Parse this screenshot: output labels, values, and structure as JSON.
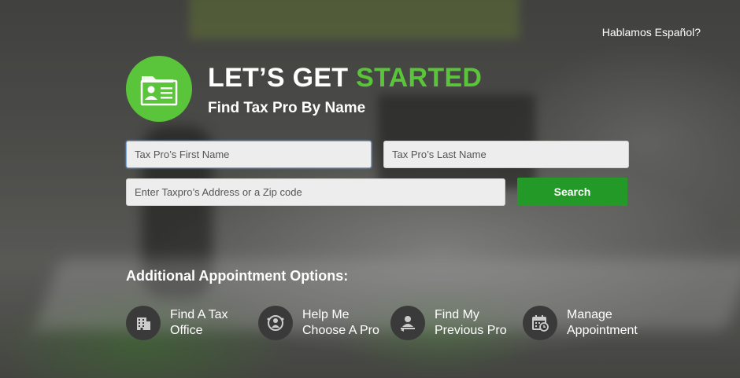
{
  "header": {
    "language_link": "Hablamos Español?"
  },
  "hero": {
    "title_part1": "LET’S GET",
    "title_part2": "STARTED",
    "subtitle": "Find Tax Pro By Name"
  },
  "form": {
    "first_name_placeholder": "Tax Pro’s First Name",
    "last_name_placeholder": "Tax Pro’s Last Name",
    "address_placeholder": "Enter Taxpro’s Address or a Zip code",
    "search_label": "Search"
  },
  "options": {
    "title": "Additional Appointment Options:",
    "items": [
      {
        "line1": "Find A Tax",
        "line2": "Office",
        "icon": "building-icon"
      },
      {
        "line1": "Help Me",
        "line2": "Choose A Pro",
        "icon": "person-help-icon"
      },
      {
        "line1": "Find My",
        "line2": "Previous Pro",
        "icon": "person-search-icon"
      },
      {
        "line1": "Manage",
        "line2": "Appointment",
        "icon": "calendar-clock-icon"
      }
    ]
  },
  "colors": {
    "accent_green": "#5ac43a",
    "button_green": "#239a27"
  }
}
